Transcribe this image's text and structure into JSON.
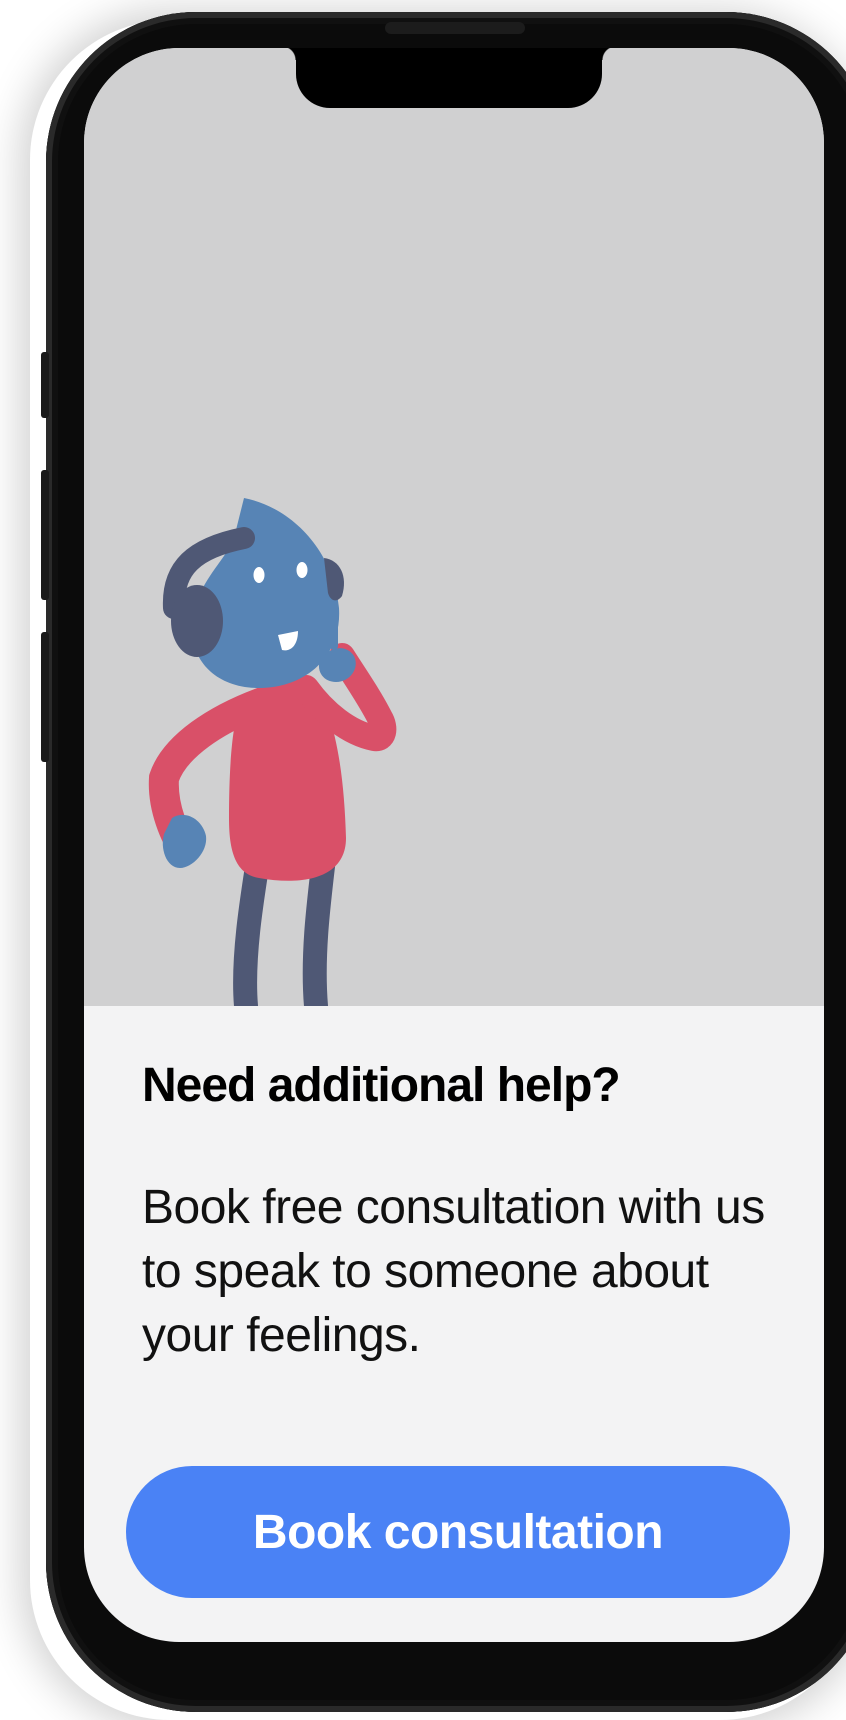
{
  "colors": {
    "illustration_bg": "#d0d0d1",
    "screen_bg": "#f3f3f4",
    "button_bg": "#4a82f5",
    "character_skin": "#5784b5",
    "character_shirt": "#d95068",
    "character_legs": "#4f5875",
    "headphones": "#4f5875"
  },
  "illustration": {
    "icon": "character-with-headphones-icon"
  },
  "help": {
    "title": "Need additional help?",
    "body": "Book free consultation with us to speak to someone about your feelings.",
    "cta_label": "Book consultation"
  }
}
